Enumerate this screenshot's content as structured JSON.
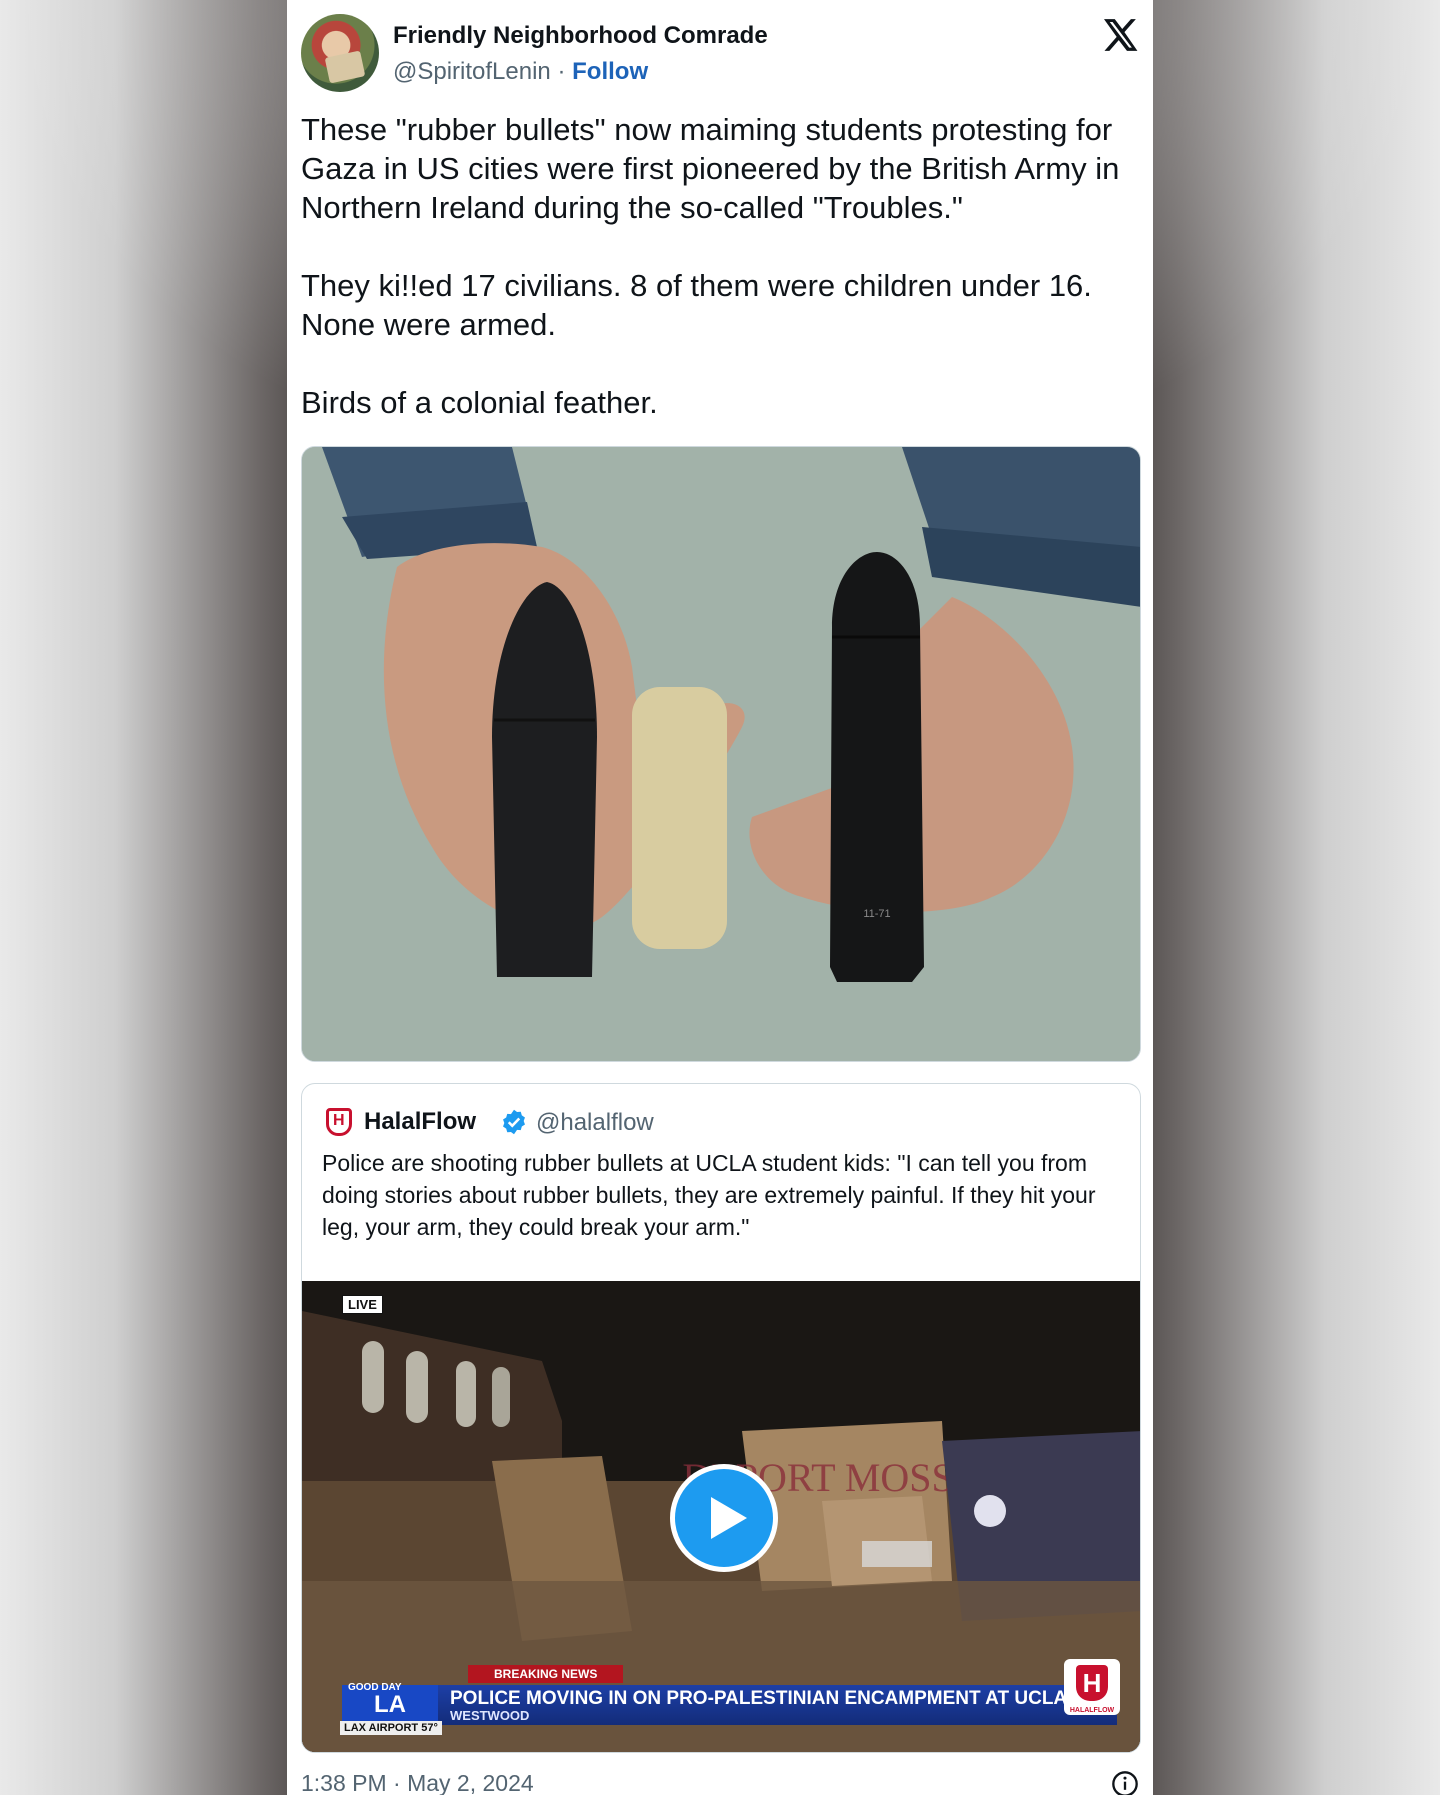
{
  "header": {
    "display_name": "Friendly Neighborhood Comrade",
    "handle": "@SpiritofLenin",
    "separator": "·",
    "follow_label": "Follow"
  },
  "tweet": {
    "paragraphs": [
      "These \"rubber bullets\" now maiming students protesting for Gaza in US cities were first pioneered by the British Army in Northern Ireland during the so-called \"Troubles.\"",
      "They ki!!ed 17 civilians. 8 of them were children under 16. None were armed.",
      "Birds of a colonial feather."
    ],
    "timestamp": "1:38 PM · May 2, 2024"
  },
  "photo": {
    "imprint": "11-71"
  },
  "quote": {
    "name": "HalalFlow",
    "handle": "@halalflow",
    "text": "Police are shooting rubber bullets at UCLA student kids: \"I can tell you from doing stories about rubber bullets, they are extremely painful. If they hit your leg, your arm, they could break your arm.\""
  },
  "video": {
    "live_label": "LIVE",
    "breaking_label": "BREAKING NEWS",
    "headline": "POLICE MOVING IN ON PRO-PALESTINIAN ENCAMPMENT AT UCLA",
    "subline": "WESTWOOD",
    "station_logo": "LA",
    "station_logo_small": "GOOD DAY",
    "weather_label": "LAX AIRPORT 57°",
    "sign_text": "DEPORT MOSSAD",
    "corner_logo_label": "HALALFLOW"
  },
  "colors": {
    "link": "#1d63b8",
    "verified": "#1d9bf0",
    "play": "#1d9bf0",
    "brand_red": "#c8102e"
  },
  "icons": {
    "x_logo": "x-logo-icon",
    "verified": "verified-badge-icon",
    "play": "play-icon",
    "info": "info-icon"
  }
}
